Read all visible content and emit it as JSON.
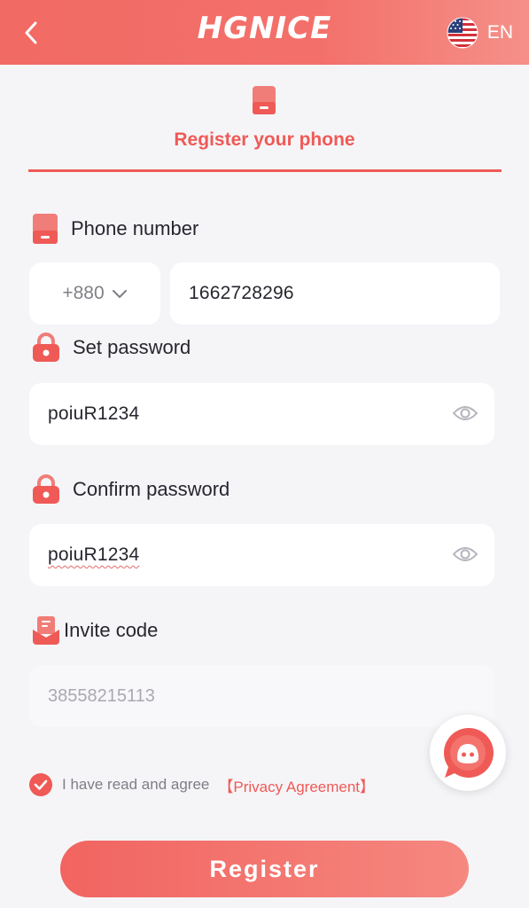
{
  "header": {
    "logo": "HGNICE",
    "language": "EN"
  },
  "step": {
    "title": "Register your phone"
  },
  "phone": {
    "label": "Phone number",
    "country_code": "+880",
    "value": "1662728296"
  },
  "password": {
    "label": "Set password",
    "value": "poiuR1234"
  },
  "confirm_password": {
    "label": "Confirm password",
    "value": "poiuR1234"
  },
  "invite": {
    "label": "Invite code",
    "placeholder": "38558215113"
  },
  "agreement": {
    "text": "I have read and agree",
    "link": "【Privacy Agreement】",
    "checked": true
  },
  "register_button": "Register",
  "colors": {
    "accent": "#ef5a56",
    "header": "#f26a64",
    "background": "#f5f5f8"
  }
}
